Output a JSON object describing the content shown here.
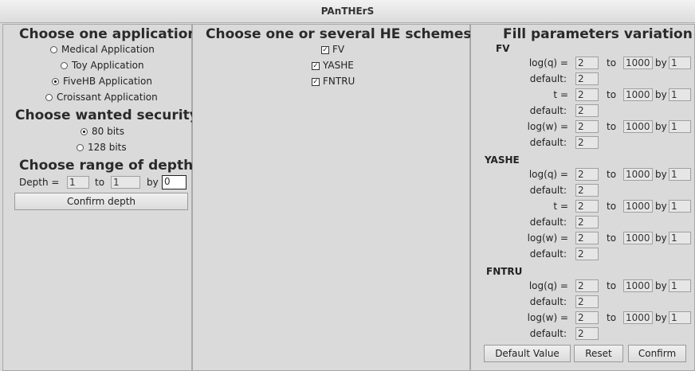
{
  "window": {
    "title": "PAnTHErS"
  },
  "left": {
    "app_heading": "Choose one application",
    "apps": [
      {
        "label": "Medical Application",
        "selected": false
      },
      {
        "label": "Toy Application",
        "selected": false
      },
      {
        "label": "FiveHB Application",
        "selected": true
      },
      {
        "label": "Croissant Application",
        "selected": false
      }
    ],
    "security_heading": "Choose wanted security",
    "security": [
      {
        "label": "80 bits",
        "selected": true
      },
      {
        "label": "128 bits",
        "selected": false
      }
    ],
    "depth_heading": "Choose range of depth",
    "depth_label": "Depth =",
    "depth_from": "1",
    "to_label": "to",
    "depth_to": "1",
    "by_label": "by",
    "depth_by": "0",
    "confirm_depth": "Confirm depth"
  },
  "middle": {
    "heading": "Choose one or several HE schemes",
    "schemes": [
      {
        "label": "FV",
        "checked": true
      },
      {
        "label": "YASHE",
        "checked": true
      },
      {
        "label": "FNTRU",
        "checked": true
      }
    ]
  },
  "right": {
    "heading": "Fill parameters variation",
    "to": "to",
    "by": "by",
    "default_label": "default:",
    "schemes": [
      {
        "name": "FV",
        "params": [
          {
            "label": "log(q) =",
            "from": "2",
            "to": "1000",
            "by": "1",
            "default": "2"
          },
          {
            "label": "t =",
            "from": "2",
            "to": "1000",
            "by": "1",
            "default": "2"
          },
          {
            "label": "log(w) =",
            "from": "2",
            "to": "1000",
            "by": "1",
            "default": "2"
          }
        ]
      },
      {
        "name": "YASHE",
        "params": [
          {
            "label": "log(q) =",
            "from": "2",
            "to": "1000",
            "by": "1",
            "default": "2"
          },
          {
            "label": "t =",
            "from": "2",
            "to": "1000",
            "by": "1",
            "default": "2"
          },
          {
            "label": "log(w) =",
            "from": "2",
            "to": "1000",
            "by": "1",
            "default": "2"
          }
        ]
      },
      {
        "name": "FNTRU",
        "params": [
          {
            "label": "log(q) =",
            "from": "2",
            "to": "1000",
            "by": "1",
            "default": "2"
          },
          {
            "label": "log(w) =",
            "from": "2",
            "to": "1000",
            "by": "1",
            "default": "2"
          }
        ]
      }
    ],
    "buttons": {
      "default": "Default Value",
      "reset": "Reset",
      "confirm": "Confirm"
    }
  }
}
